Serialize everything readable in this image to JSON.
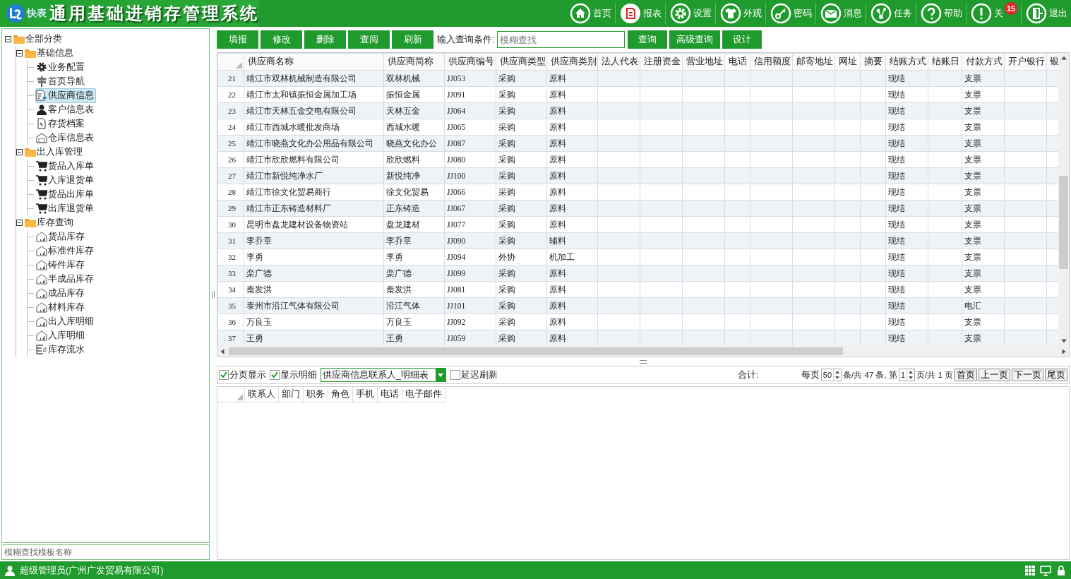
{
  "header": {
    "logo_text": "快表",
    "title": "通用基础进销存管理系统",
    "nav": [
      {
        "kind": "home",
        "label": "首页"
      },
      {
        "kind": "report",
        "label": "报表"
      },
      {
        "kind": "settings",
        "label": "设置"
      },
      {
        "kind": "shirt",
        "label": "外观"
      },
      {
        "kind": "key",
        "label": "密码"
      },
      {
        "kind": "mail",
        "label": "消息"
      },
      {
        "kind": "task",
        "label": "任务"
      },
      {
        "kind": "help",
        "label": "帮助"
      },
      {
        "kind": "info",
        "label": "关",
        "badge": "15"
      },
      {
        "kind": "exit",
        "label": "退出"
      }
    ]
  },
  "tree": [
    {
      "kind": "folder",
      "label": "全部分类",
      "expanded": true,
      "selected": false,
      "children": [
        {
          "kind": "folder",
          "label": "基础信息",
          "expanded": true,
          "selected": false,
          "children": [
            {
              "kind": "gear",
              "label": "业务配置",
              "selected": false
            },
            {
              "kind": "signpost",
              "label": "首页导航",
              "selected": false
            },
            {
              "kind": "supplier",
              "label": "供应商信息",
              "selected": true
            },
            {
              "kind": "person",
              "label": "客户信息表",
              "selected": false
            },
            {
              "kind": "file",
              "label": "存货档案",
              "selected": false
            },
            {
              "kind": "warehouse",
              "label": "仓库信息表",
              "selected": false
            }
          ]
        },
        {
          "kind": "folder",
          "label": "出入库管理",
          "expanded": true,
          "selected": false,
          "children": [
            {
              "kind": "cart",
              "label": "货品入库单",
              "selected": false
            },
            {
              "kind": "cart",
              "label": "入库退货单",
              "selected": false
            },
            {
              "kind": "cart",
              "label": "货品出库单",
              "selected": false
            },
            {
              "kind": "cart",
              "label": "出库退货单",
              "selected": false
            }
          ]
        },
        {
          "kind": "folder",
          "label": "库存查询",
          "expanded": true,
          "selected": false,
          "children": [
            {
              "kind": "store",
              "label": "货品库存",
              "selected": false
            },
            {
              "kind": "store",
              "label": "标准件库存",
              "selected": false
            },
            {
              "kind": "store",
              "label": "铸件库存",
              "selected": false
            },
            {
              "kind": "store",
              "label": "半成品库存",
              "selected": false
            },
            {
              "kind": "store",
              "label": "成品库存",
              "selected": false
            },
            {
              "kind": "store",
              "label": "材料库存",
              "selected": false
            },
            {
              "kind": "store",
              "label": "出入库明细",
              "selected": false
            },
            {
              "kind": "store",
              "label": "入库明细",
              "selected": false
            },
            {
              "kind": "flow",
              "label": "库存流水",
              "selected": false
            }
          ]
        }
      ]
    }
  ],
  "template_search": {
    "placeholder": "模糊查找模板名称"
  },
  "toolbar": {
    "buttons": [
      "填报",
      "修改",
      "删除",
      "查阅",
      "刷新"
    ],
    "query_label": "输入查询条件:",
    "query": {
      "placeholder": "模糊查找"
    },
    "query_buttons": [
      "查询",
      "高级查询",
      "设计"
    ]
  },
  "table": {
    "columns": [
      "供应商名称",
      "供应商简称",
      "供应商编号",
      "供应商类型",
      "供应商类别",
      "法人代表",
      "注册资金",
      "营业地址",
      "电话",
      "信用额度",
      "邮寄地址",
      "网址",
      "摘要",
      "结账方式",
      "结账日",
      "付款方式",
      "开户银行",
      "银"
    ],
    "rows": [
      {
        "num": "21",
        "name": "靖江市双林机械制造有限公司",
        "short": "双林机械",
        "code": "JJ053",
        "type": "采购",
        "category": "原料",
        "settle": "现结",
        "pay": "支票"
      },
      {
        "num": "22",
        "name": "靖江市太和镇振恒金属加工场",
        "short": "振恒金属",
        "code": "JJ091",
        "type": "采购",
        "category": "原料",
        "settle": "现结",
        "pay": "支票"
      },
      {
        "num": "23",
        "name": "靖江市天林五金交电有限公司",
        "short": "天林五金",
        "code": "JJ064",
        "type": "采购",
        "category": "原料",
        "settle": "现结",
        "pay": "支票"
      },
      {
        "num": "24",
        "name": "靖江市西城水暖批发商场",
        "short": "西城水暖",
        "code": "JJ065",
        "type": "采购",
        "category": "原料",
        "settle": "现结",
        "pay": "支票"
      },
      {
        "num": "25",
        "name": "靖江市晓燕文化办公用品有限公司",
        "short": "晓燕文化办公",
        "code": "JJ087",
        "type": "采购",
        "category": "原料",
        "settle": "现结",
        "pay": "支票"
      },
      {
        "num": "26",
        "name": "靖江市欣欣燃料有限公司",
        "short": "欣欣燃料",
        "code": "JJ080",
        "type": "采购",
        "category": "原料",
        "settle": "现结",
        "pay": "支票"
      },
      {
        "num": "27",
        "name": "靖江市新悦纯净水厂",
        "short": "新悦纯净",
        "code": "JJ100",
        "type": "采购",
        "category": "原料",
        "settle": "现结",
        "pay": "支票"
      },
      {
        "num": "28",
        "name": "靖江市徐文化贸易商行",
        "short": "徐文化贸易",
        "code": "JJ066",
        "type": "采购",
        "category": "原料",
        "settle": "现结",
        "pay": "支票"
      },
      {
        "num": "29",
        "name": "靖江市正东铸造材料厂",
        "short": "正东铸造",
        "code": "JJ067",
        "type": "采购",
        "category": "原料",
        "settle": "现结",
        "pay": "支票"
      },
      {
        "num": "30",
        "name": "昆明市盘龙建材设备物资站",
        "short": "盘龙建材",
        "code": "JJ077",
        "type": "采购",
        "category": "原料",
        "settle": "现结",
        "pay": "支票"
      },
      {
        "num": "31",
        "name": "李乔章",
        "short": "李乔章",
        "code": "JJ090",
        "type": "采购",
        "category": "辅料",
        "settle": "现结",
        "pay": "支票"
      },
      {
        "num": "32",
        "name": "李勇",
        "short": "李勇",
        "code": "JJ094",
        "type": "外协",
        "category": "机加工",
        "settle": "现结",
        "pay": "支票"
      },
      {
        "num": "33",
        "name": "栾广德",
        "short": "栾广德",
        "code": "JJ099",
        "type": "采购",
        "category": "原料",
        "settle": "现结",
        "pay": "支票"
      },
      {
        "num": "34",
        "name": "秦发洪",
        "short": "秦发洪",
        "code": "JJ081",
        "type": "采购",
        "category": "原料",
        "settle": "现结",
        "pay": "支票"
      },
      {
        "num": "35",
        "name": "泰州市沿江气体有限公司",
        "short": "沿江气体",
        "code": "JJ101",
        "type": "采购",
        "category": "原料",
        "settle": "现结",
        "pay": "电汇"
      },
      {
        "num": "36",
        "name": "万良玉",
        "short": "万良玉",
        "code": "JJ092",
        "type": "采购",
        "category": "原料",
        "settle": "现结",
        "pay": "支票"
      },
      {
        "num": "37",
        "name": "王勇",
        "short": "王勇",
        "code": "JJ059",
        "type": "采购",
        "category": "原料",
        "settle": "现结",
        "pay": "支票"
      }
    ]
  },
  "detail_bar": {
    "checks": [
      {
        "label": "分页显示",
        "checked": true
      },
      {
        "label": "显示明细",
        "checked": true
      }
    ],
    "detail_select": "供应商信息联系人_明细表",
    "delay": {
      "label": "延迟刷新",
      "checked": false
    },
    "total_label": "合计:",
    "pager": {
      "per_page_label": "每页",
      "per_page": "50",
      "total_text": "条/共 47 条, 第",
      "page": "1",
      "pages_text": "页/共 1 页",
      "buttons": [
        "首页",
        "上一页",
        "下一页",
        "尾页"
      ]
    }
  },
  "detail_table": {
    "columns": [
      "联系人",
      "部门",
      "职务",
      "角色",
      "手机",
      "电话",
      "电子邮件"
    ]
  },
  "status_bar": {
    "user": "超级管理员(广州广发贸易有限公司)"
  }
}
